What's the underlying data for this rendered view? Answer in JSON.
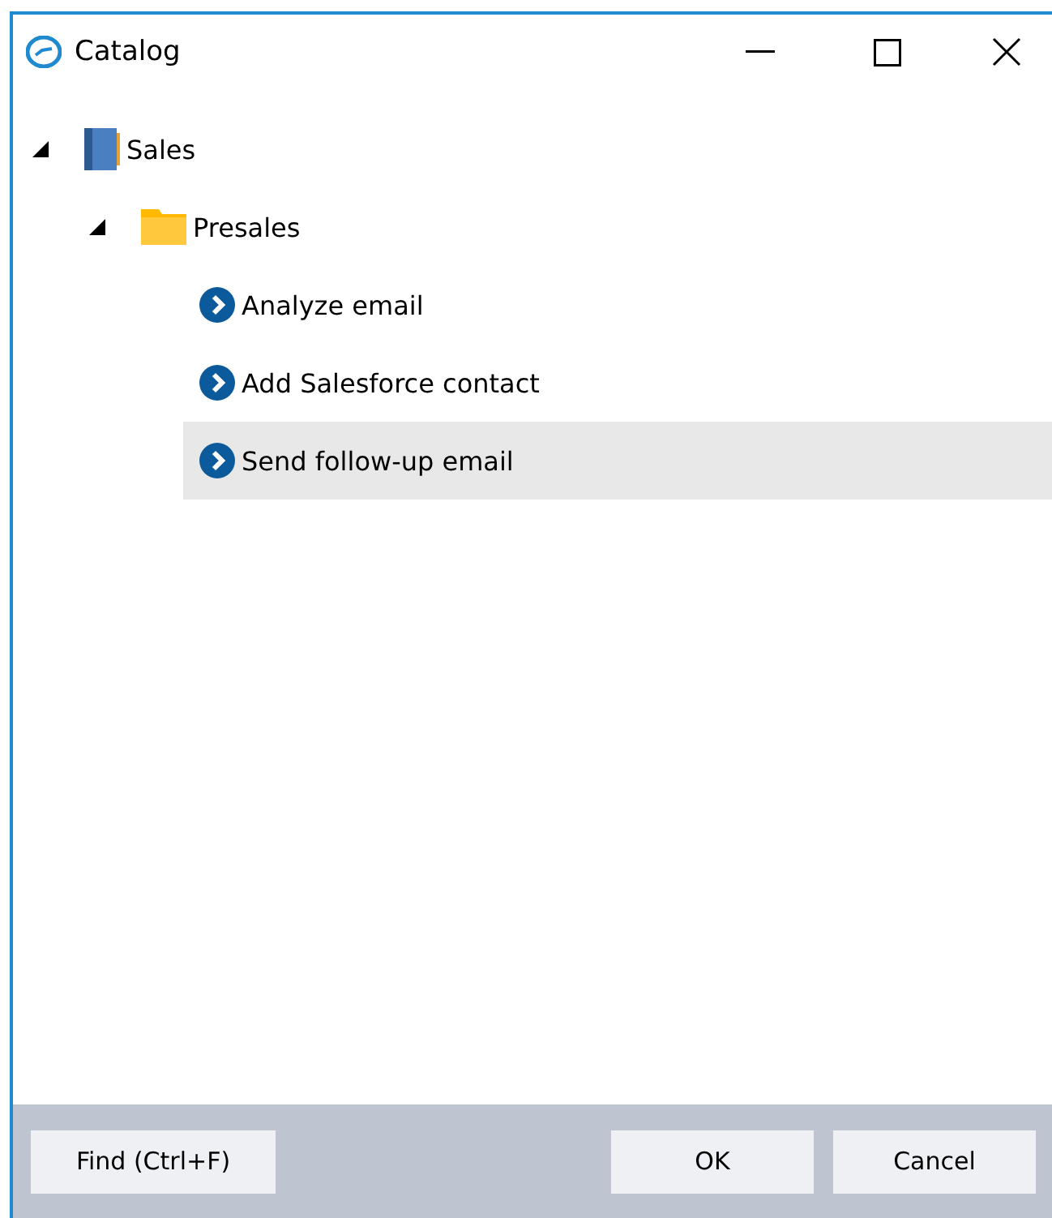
{
  "window": {
    "title": "Catalog"
  },
  "tree": [
    {
      "label": "Sales",
      "kind": "book",
      "expanded": true,
      "selected": false,
      "children": [
        {
          "label": "Presales",
          "kind": "folder",
          "expanded": true,
          "selected": false,
          "children": [
            {
              "label": "Analyze email",
              "kind": "action",
              "selected": false
            },
            {
              "label": "Add Salesforce contact",
              "kind": "action",
              "selected": false
            },
            {
              "label": "Send follow-up email",
              "kind": "action",
              "selected": true
            }
          ]
        }
      ]
    }
  ],
  "buttons": {
    "find": "Find (Ctrl+F)",
    "ok": "OK",
    "cancel": "Cancel"
  }
}
